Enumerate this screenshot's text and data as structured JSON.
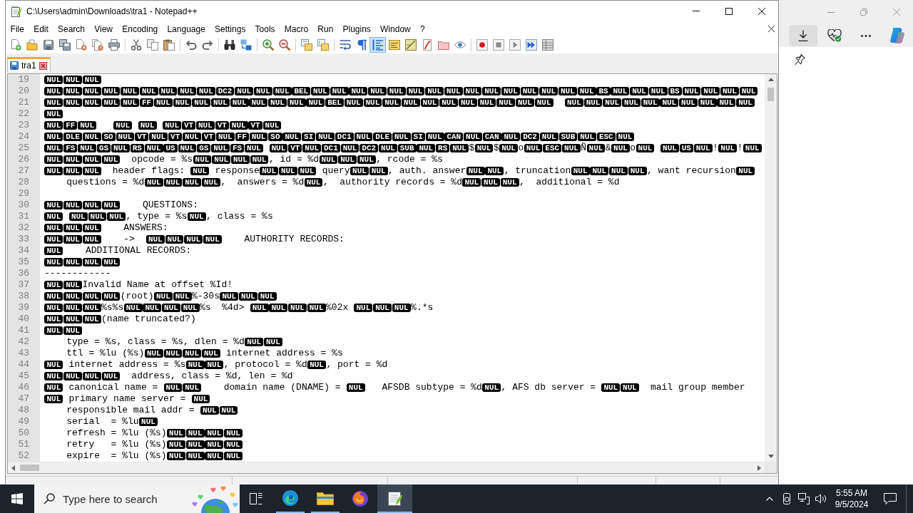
{
  "window": {
    "title": "C:\\Users\\admin\\Downloads\\tra1 - Notepad++"
  },
  "menu": [
    "File",
    "Edit",
    "Search",
    "View",
    "Encoding",
    "Language",
    "Settings",
    "Tools",
    "Macro",
    "Run",
    "Plugins",
    "Window",
    "?"
  ],
  "toolbar": {
    "buttons": [
      {
        "on": false
      },
      {
        "on": false
      },
      {
        "on": false
      },
      {
        "on": false
      },
      {
        "on": false
      },
      {
        "on": false
      },
      {
        "on": false
      },
      {
        "on": false
      },
      {
        "on": false
      },
      {
        "on": false
      },
      {
        "on": false
      },
      {
        "on": false
      },
      {
        "on": false
      },
      {
        "on": false
      },
      {
        "on": false
      },
      {
        "on": false
      },
      {
        "on": false
      },
      {
        "on": false
      },
      {
        "on": false
      },
      {
        "on": false
      },
      {
        "on": true
      },
      {
        "on": false
      },
      {
        "on": false
      },
      {
        "on": false
      },
      {
        "on": false
      },
      {
        "on": false
      },
      {
        "on": false
      },
      {
        "on": false
      },
      {
        "on": false
      },
      {
        "on": false
      },
      {
        "on": false
      }
    ]
  },
  "tabs": [
    {
      "label": "tra1",
      "selected": true
    }
  ],
  "editor": {
    "lines": [
      {
        "number": "19",
        "segments": [
          {
            "kind": "ctrl",
            "codes": [
              "NUL",
              "NUL",
              "NUL"
            ]
          }
        ]
      },
      {
        "number": "20",
        "segments": [
          {
            "kind": "ctrl",
            "codes": [
              "NUL",
              "NUL",
              "NUL",
              "NUL",
              "NUL",
              "NUL",
              "NUL",
              "NUL",
              "NUL",
              "DC2",
              "NUL",
              "NUL",
              "NUL",
              "BEL",
              "NUL",
              "NUL",
              "NUL",
              "NUL",
              "NUL",
              "NUL",
              "NUL",
              "NUL",
              "NUL",
              "NUL",
              "NUL",
              "NUL",
              "NUL",
              "NUL",
              "NUL",
              "BS",
              "NUL",
              "NUL",
              "NUL",
              "BS",
              "NUL",
              "NUL",
              "NUL",
              "NUL"
            ]
          }
        ]
      },
      {
        "number": "21",
        "segments": [
          {
            "kind": "ctrl",
            "codes": [
              "NUL",
              "NUL",
              "NUL",
              "NUL",
              "NUL",
              "FF",
              "NUL",
              "NUL",
              "NUL",
              "NUL",
              "NUL",
              "NUL",
              "NUL",
              "NUL",
              "NUL",
              "BEL",
              "NUL",
              "NUL",
              "NUL",
              "NUL",
              "NUL",
              "NUL",
              "NUL",
              "NUL",
              "NUL",
              "NUL",
              "NUL"
            ]
          },
          {
            "kind": "space"
          },
          {
            "kind": "space"
          },
          {
            "kind": "ctrl",
            "codes": [
              "NUL",
              "NUL",
              "NUL",
              "NUL",
              "NUL",
              "NUL",
              "NUL",
              "NUL",
              "NUL",
              "NUL"
            ]
          }
        ]
      },
      {
        "number": "22",
        "segments": [
          {
            "kind": "ctrl",
            "codes": [
              "NUL"
            ]
          }
        ]
      },
      {
        "number": "23",
        "segments": [
          {
            "kind": "ctrl",
            "codes": [
              "NUL",
              "FF",
              "NUL"
            ]
          },
          {
            "kind": "space"
          },
          {
            "kind": "space"
          },
          {
            "kind": "space"
          },
          {
            "kind": "ctrl",
            "codes": [
              "NUL"
            ]
          },
          {
            "kind": "space"
          },
          {
            "kind": "ctrl",
            "codes": [
              "NUL"
            ]
          },
          {
            "kind": "space"
          },
          {
            "kind": "ctrl",
            "codes": [
              "NUL",
              "VT",
              "NUL",
              "VT",
              "NUL",
              "VT",
              "NUL"
            ]
          }
        ]
      },
      {
        "number": "24",
        "segments": [
          {
            "kind": "ctrl",
            "codes": [
              "NUL",
              "DLE",
              "NUL",
              "SO",
              "NUL",
              "VT",
              "NUL",
              "VT",
              "NUL",
              "VT",
              "NUL",
              "FF",
              "NUL",
              "SO",
              "NUL",
              "SI",
              "NUL",
              "DC1",
              "NUL",
              "DLE",
              "NUL",
              "SI",
              "NUL",
              "CAN",
              "NUL",
              "CAN",
              "NUL",
              "DC2",
              "NUL",
              "SUB",
              "NUL",
              "ESC",
              "NUL"
            ]
          }
        ]
      },
      {
        "number": "25",
        "segments": [
          {
            "kind": "ctrl",
            "codes": [
              "NUL",
              "FS",
              "NUL",
              "GS",
              "NUL",
              "RS",
              "NUL",
              "US",
              "NUL",
              "GS",
              "NUL",
              "FS",
              "NUL"
            ]
          },
          {
            "kind": "space"
          },
          {
            "kind": "ctrl",
            "codes": [
              "NUL",
              "VT",
              "NUL",
              "DC1",
              "NUL",
              "DC2",
              "NUL",
              "SUB",
              "NUL",
              "RS",
              "NUL"
            ]
          },
          {
            "kind": "text",
            "text": "$"
          },
          {
            "kind": "ctrl",
            "codes": [
              "NUL"
            ]
          },
          {
            "kind": "text",
            "text": "$"
          },
          {
            "kind": "ctrl",
            "codes": [
              "NUL"
            ]
          },
          {
            "kind": "text",
            "text": "o"
          },
          {
            "kind": "ctrl",
            "codes": [
              "NUL",
              "ESC",
              "NUL"
            ]
          },
          {
            "kind": "text",
            "text": "Ñ"
          },
          {
            "kind": "ctrl",
            "codes": [
              "NUL"
            ]
          },
          {
            "kind": "text",
            "text": "&"
          },
          {
            "kind": "ctrl",
            "codes": [
              "NUL"
            ]
          },
          {
            "kind": "text",
            "text": "o"
          },
          {
            "kind": "ctrl",
            "codes": [
              "NUL"
            ]
          },
          {
            "kind": "space"
          },
          {
            "kind": "ctrl",
            "codes": [
              "NUL",
              "US",
              "NUL"
            ]
          },
          {
            "kind": "text",
            "text": "!"
          },
          {
            "kind": "ctrl",
            "codes": [
              "NUL"
            ]
          },
          {
            "kind": "text",
            "text": "!"
          },
          {
            "kind": "ctrl",
            "codes": [
              "NUL"
            ]
          }
        ]
      },
      {
        "number": "26",
        "segments": [
          {
            "kind": "ctrl",
            "codes": [
              "NUL",
              "NUL",
              "NUL",
              "NUL"
            ]
          },
          {
            "kind": "text",
            "text": "  opcode = %s"
          },
          {
            "kind": "ctrl",
            "codes": [
              "NUL",
              "NUL",
              "NUL",
              "NUL"
            ]
          },
          {
            "kind": "text",
            "text": ", id = %d"
          },
          {
            "kind": "ctrl",
            "codes": [
              "NUL",
              "NUL",
              "NUL"
            ]
          },
          {
            "kind": "text",
            "text": ", rcode = %s"
          }
        ]
      },
      {
        "number": "27",
        "segments": [
          {
            "kind": "ctrl",
            "codes": [
              "NUL",
              "NUL",
              "NUL"
            ]
          },
          {
            "kind": "text",
            "text": "  header flags: "
          },
          {
            "kind": "ctrl",
            "codes": [
              "NUL"
            ]
          },
          {
            "kind": "text",
            "text": " response"
          },
          {
            "kind": "ctrl",
            "codes": [
              "NUL",
              "NUL",
              "NUL"
            ]
          },
          {
            "kind": "text",
            "text": " query"
          },
          {
            "kind": "ctrl",
            "codes": [
              "NUL",
              "NUL"
            ]
          },
          {
            "kind": "text",
            "text": ", auth. answer"
          },
          {
            "kind": "ctrl",
            "codes": [
              "NUL",
              "NUL"
            ]
          },
          {
            "kind": "text",
            "text": ", truncation"
          },
          {
            "kind": "ctrl",
            "codes": [
              "NUL",
              "NUL",
              "NUL",
              "NUL"
            ]
          },
          {
            "kind": "text",
            "text": ", want recursion"
          },
          {
            "kind": "ctrl",
            "codes": [
              "NUL"
            ]
          }
        ]
      },
      {
        "number": "28",
        "segments": [
          {
            "kind": "text",
            "text": "    questions = %d"
          },
          {
            "kind": "ctrl",
            "codes": [
              "NUL",
              "NUL",
              "NUL",
              "NUL"
            ]
          },
          {
            "kind": "text",
            "text": ",  answers = %d"
          },
          {
            "kind": "ctrl",
            "codes": [
              "NUL"
            ]
          },
          {
            "kind": "text",
            "text": ",  authority records = %d"
          },
          {
            "kind": "ctrl",
            "codes": [
              "NUL",
              "NUL",
              "NUL"
            ]
          },
          {
            "kind": "text",
            "text": ",  additional = %d"
          }
        ]
      },
      {
        "number": "29"
      },
      {
        "number": "30",
        "segments": [
          {
            "kind": "ctrl",
            "codes": [
              "NUL",
              "NUL",
              "NUL",
              "NUL"
            ]
          },
          {
            "kind": "text",
            "text": "    QUESTIONS:"
          }
        ]
      },
      {
        "number": "31",
        "segments": [
          {
            "kind": "ctrl",
            "codes": [
              "NUL"
            ]
          },
          {
            "kind": "space"
          },
          {
            "kind": "ctrl",
            "codes": [
              "NUL",
              "NUL",
              "NUL"
            ]
          },
          {
            "kind": "text",
            "text": ", type = %s"
          },
          {
            "kind": "ctrl",
            "codes": [
              "NUL"
            ]
          },
          {
            "kind": "text",
            "text": ", class = %s"
          }
        ]
      },
      {
        "number": "32",
        "segments": [
          {
            "kind": "ctrl",
            "codes": [
              "NUL",
              "NUL",
              "NUL"
            ]
          },
          {
            "kind": "text",
            "text": "    ANSWERS:"
          }
        ]
      },
      {
        "number": "33",
        "segments": [
          {
            "kind": "ctrl",
            "codes": [
              "NUL",
              "NUL",
              "NUL"
            ]
          },
          {
            "kind": "text",
            "text": "    ->  "
          },
          {
            "kind": "ctrl",
            "codes": [
              "NUL",
              "NUL",
              "NUL",
              "NUL"
            ]
          },
          {
            "kind": "text",
            "text": "    AUTHORITY RECORDS:"
          }
        ]
      },
      {
        "number": "34",
        "segments": [
          {
            "kind": "ctrl",
            "codes": [
              "NUL"
            ]
          },
          {
            "kind": "text",
            "text": "    ADDITIONAL RECORDS:"
          }
        ]
      },
      {
        "number": "35",
        "segments": [
          {
            "kind": "ctrl",
            "codes": [
              "NUL",
              "NUL",
              "NUL",
              "NUL"
            ]
          }
        ]
      },
      {
        "number": "36",
        "segments": [
          {
            "kind": "text",
            "text": "------------"
          }
        ]
      },
      {
        "number": "37",
        "segments": [
          {
            "kind": "ctrl",
            "codes": [
              "NUL",
              "NUL"
            ]
          },
          {
            "kind": "text",
            "text": "Invalid Name at offset %Id!"
          }
        ]
      },
      {
        "number": "38",
        "segments": [
          {
            "kind": "ctrl",
            "codes": [
              "NUL",
              "NUL",
              "NUL",
              "NUL"
            ]
          },
          {
            "kind": "text",
            "text": "(root)"
          },
          {
            "kind": "ctrl",
            "codes": [
              "NUL",
              "NUL"
            ]
          },
          {
            "kind": "text",
            "text": "%-30s"
          },
          {
            "kind": "ctrl",
            "codes": [
              "NUL",
              "NUL",
              "NUL"
            ]
          }
        ]
      },
      {
        "number": "39",
        "segments": [
          {
            "kind": "ctrl",
            "codes": [
              "NUL",
              "NUL",
              "NUL"
            ]
          },
          {
            "kind": "text",
            "text": "%s%s"
          },
          {
            "kind": "ctrl",
            "codes": [
              "NUL",
              "NUL",
              "NUL",
              "NUL"
            ]
          },
          {
            "kind": "text",
            "text": "%s  %4d> "
          },
          {
            "kind": "ctrl",
            "codes": [
              "NUL",
              "NUL",
              "NUL",
              "NUL"
            ]
          },
          {
            "kind": "text",
            "text": "%02x "
          },
          {
            "kind": "ctrl",
            "codes": [
              "NUL",
              "NUL",
              "NUL"
            ]
          },
          {
            "kind": "text",
            "text": "%.*s"
          }
        ]
      },
      {
        "number": "40",
        "segments": [
          {
            "kind": "ctrl",
            "codes": [
              "NUL",
              "NUL",
              "NUL"
            ]
          },
          {
            "kind": "text",
            "text": "(name truncated?)"
          }
        ]
      },
      {
        "number": "41",
        "segments": [
          {
            "kind": "ctrl",
            "codes": [
              "NUL",
              "NUL"
            ]
          }
        ]
      },
      {
        "number": "42",
        "segments": [
          {
            "kind": "text",
            "text": "    type = %s, class = %s, dlen = %d"
          },
          {
            "kind": "ctrl",
            "codes": [
              "NUL",
              "NUL"
            ]
          }
        ]
      },
      {
        "number": "43",
        "segments": [
          {
            "kind": "text",
            "text": "    ttl = %lu (%s)"
          },
          {
            "kind": "ctrl",
            "codes": [
              "NUL",
              "NUL",
              "NUL",
              "NUL"
            ]
          },
          {
            "kind": "text",
            "text": " internet address = %s"
          }
        ]
      },
      {
        "number": "44",
        "segments": [
          {
            "kind": "ctrl",
            "codes": [
              "NUL"
            ]
          },
          {
            "kind": "text",
            "text": " internet address = %s"
          },
          {
            "kind": "ctrl",
            "codes": [
              "NUL",
              "NUL"
            ]
          },
          {
            "kind": "text",
            "text": ", protocol = %d"
          },
          {
            "kind": "ctrl",
            "codes": [
              "NUL"
            ]
          },
          {
            "kind": "text",
            "text": ", port = %d"
          }
        ]
      },
      {
        "number": "45",
        "segments": [
          {
            "kind": "ctrl",
            "codes": [
              "NUL",
              "NUL",
              "NUL",
              "NUL"
            ]
          },
          {
            "kind": "text",
            "text": "  address, class = %d, len = %d"
          }
        ]
      },
      {
        "number": "46",
        "segments": [
          {
            "kind": "ctrl",
            "codes": [
              "NUL"
            ]
          },
          {
            "kind": "text",
            "text": " canonical name = "
          },
          {
            "kind": "ctrl",
            "codes": [
              "NUL",
              "NUL"
            ]
          },
          {
            "kind": "text",
            "text": "    domain name (DNAME) = "
          },
          {
            "kind": "ctrl",
            "codes": [
              "NUL"
            ]
          },
          {
            "kind": "text",
            "text": "   AFSDB subtype = %d"
          },
          {
            "kind": "ctrl",
            "codes": [
              "NUL"
            ]
          },
          {
            "kind": "text",
            "text": ", AFS db server = "
          },
          {
            "kind": "ctrl",
            "codes": [
              "NUL",
              "NUL"
            ]
          },
          {
            "kind": "text",
            "text": "  mail group member"
          }
        ]
      },
      {
        "number": "47",
        "segments": [
          {
            "kind": "ctrl",
            "codes": [
              "NUL"
            ]
          },
          {
            "kind": "text",
            "text": " primary name server = "
          },
          {
            "kind": "ctrl",
            "codes": [
              "NUL"
            ]
          }
        ]
      },
      {
        "number": "48",
        "segments": [
          {
            "kind": "text",
            "text": "    responsible mail addr = "
          },
          {
            "kind": "ctrl",
            "codes": [
              "NUL",
              "NUL"
            ]
          }
        ]
      },
      {
        "number": "49",
        "segments": [
          {
            "kind": "text",
            "text": "    serial  = %lu"
          },
          {
            "kind": "ctrl",
            "codes": [
              "NUL"
            ]
          }
        ]
      },
      {
        "number": "50",
        "segments": [
          {
            "kind": "text",
            "text": "    refresh = %lu (%s)"
          },
          {
            "kind": "ctrl",
            "codes": [
              "NUL",
              "NUL",
              "NUL",
              "NUL"
            ]
          }
        ]
      },
      {
        "number": "51",
        "segments": [
          {
            "kind": "text",
            "text": "    retry   = %lu (%s)"
          },
          {
            "kind": "ctrl",
            "codes": [
              "NUL",
              "NUL",
              "NUL",
              "NUL"
            ]
          }
        ]
      },
      {
        "number": "52",
        "segments": [
          {
            "kind": "text",
            "text": "    expire  = %lu (%s)"
          },
          {
            "kind": "ctrl",
            "codes": [
              "NUL",
              "NUL",
              "NUL",
              "NUL"
            ]
          }
        ]
      }
    ]
  },
  "browser": {
    "toolbar": [
      {
        "on": true
      },
      {
        "on": false
      },
      {
        "on": false
      },
      {
        "on": false
      }
    ]
  },
  "taskbar": {
    "search": {
      "placeholder": "Type here to search"
    },
    "apps": [
      {
        "running": true,
        "active": false
      },
      {
        "running": true,
        "active": false
      },
      {
        "running": false,
        "active": false
      },
      {
        "running": true,
        "active": true
      }
    ],
    "clock": {
      "time": "5:55 AM",
      "date": "9/5/2024"
    }
  }
}
